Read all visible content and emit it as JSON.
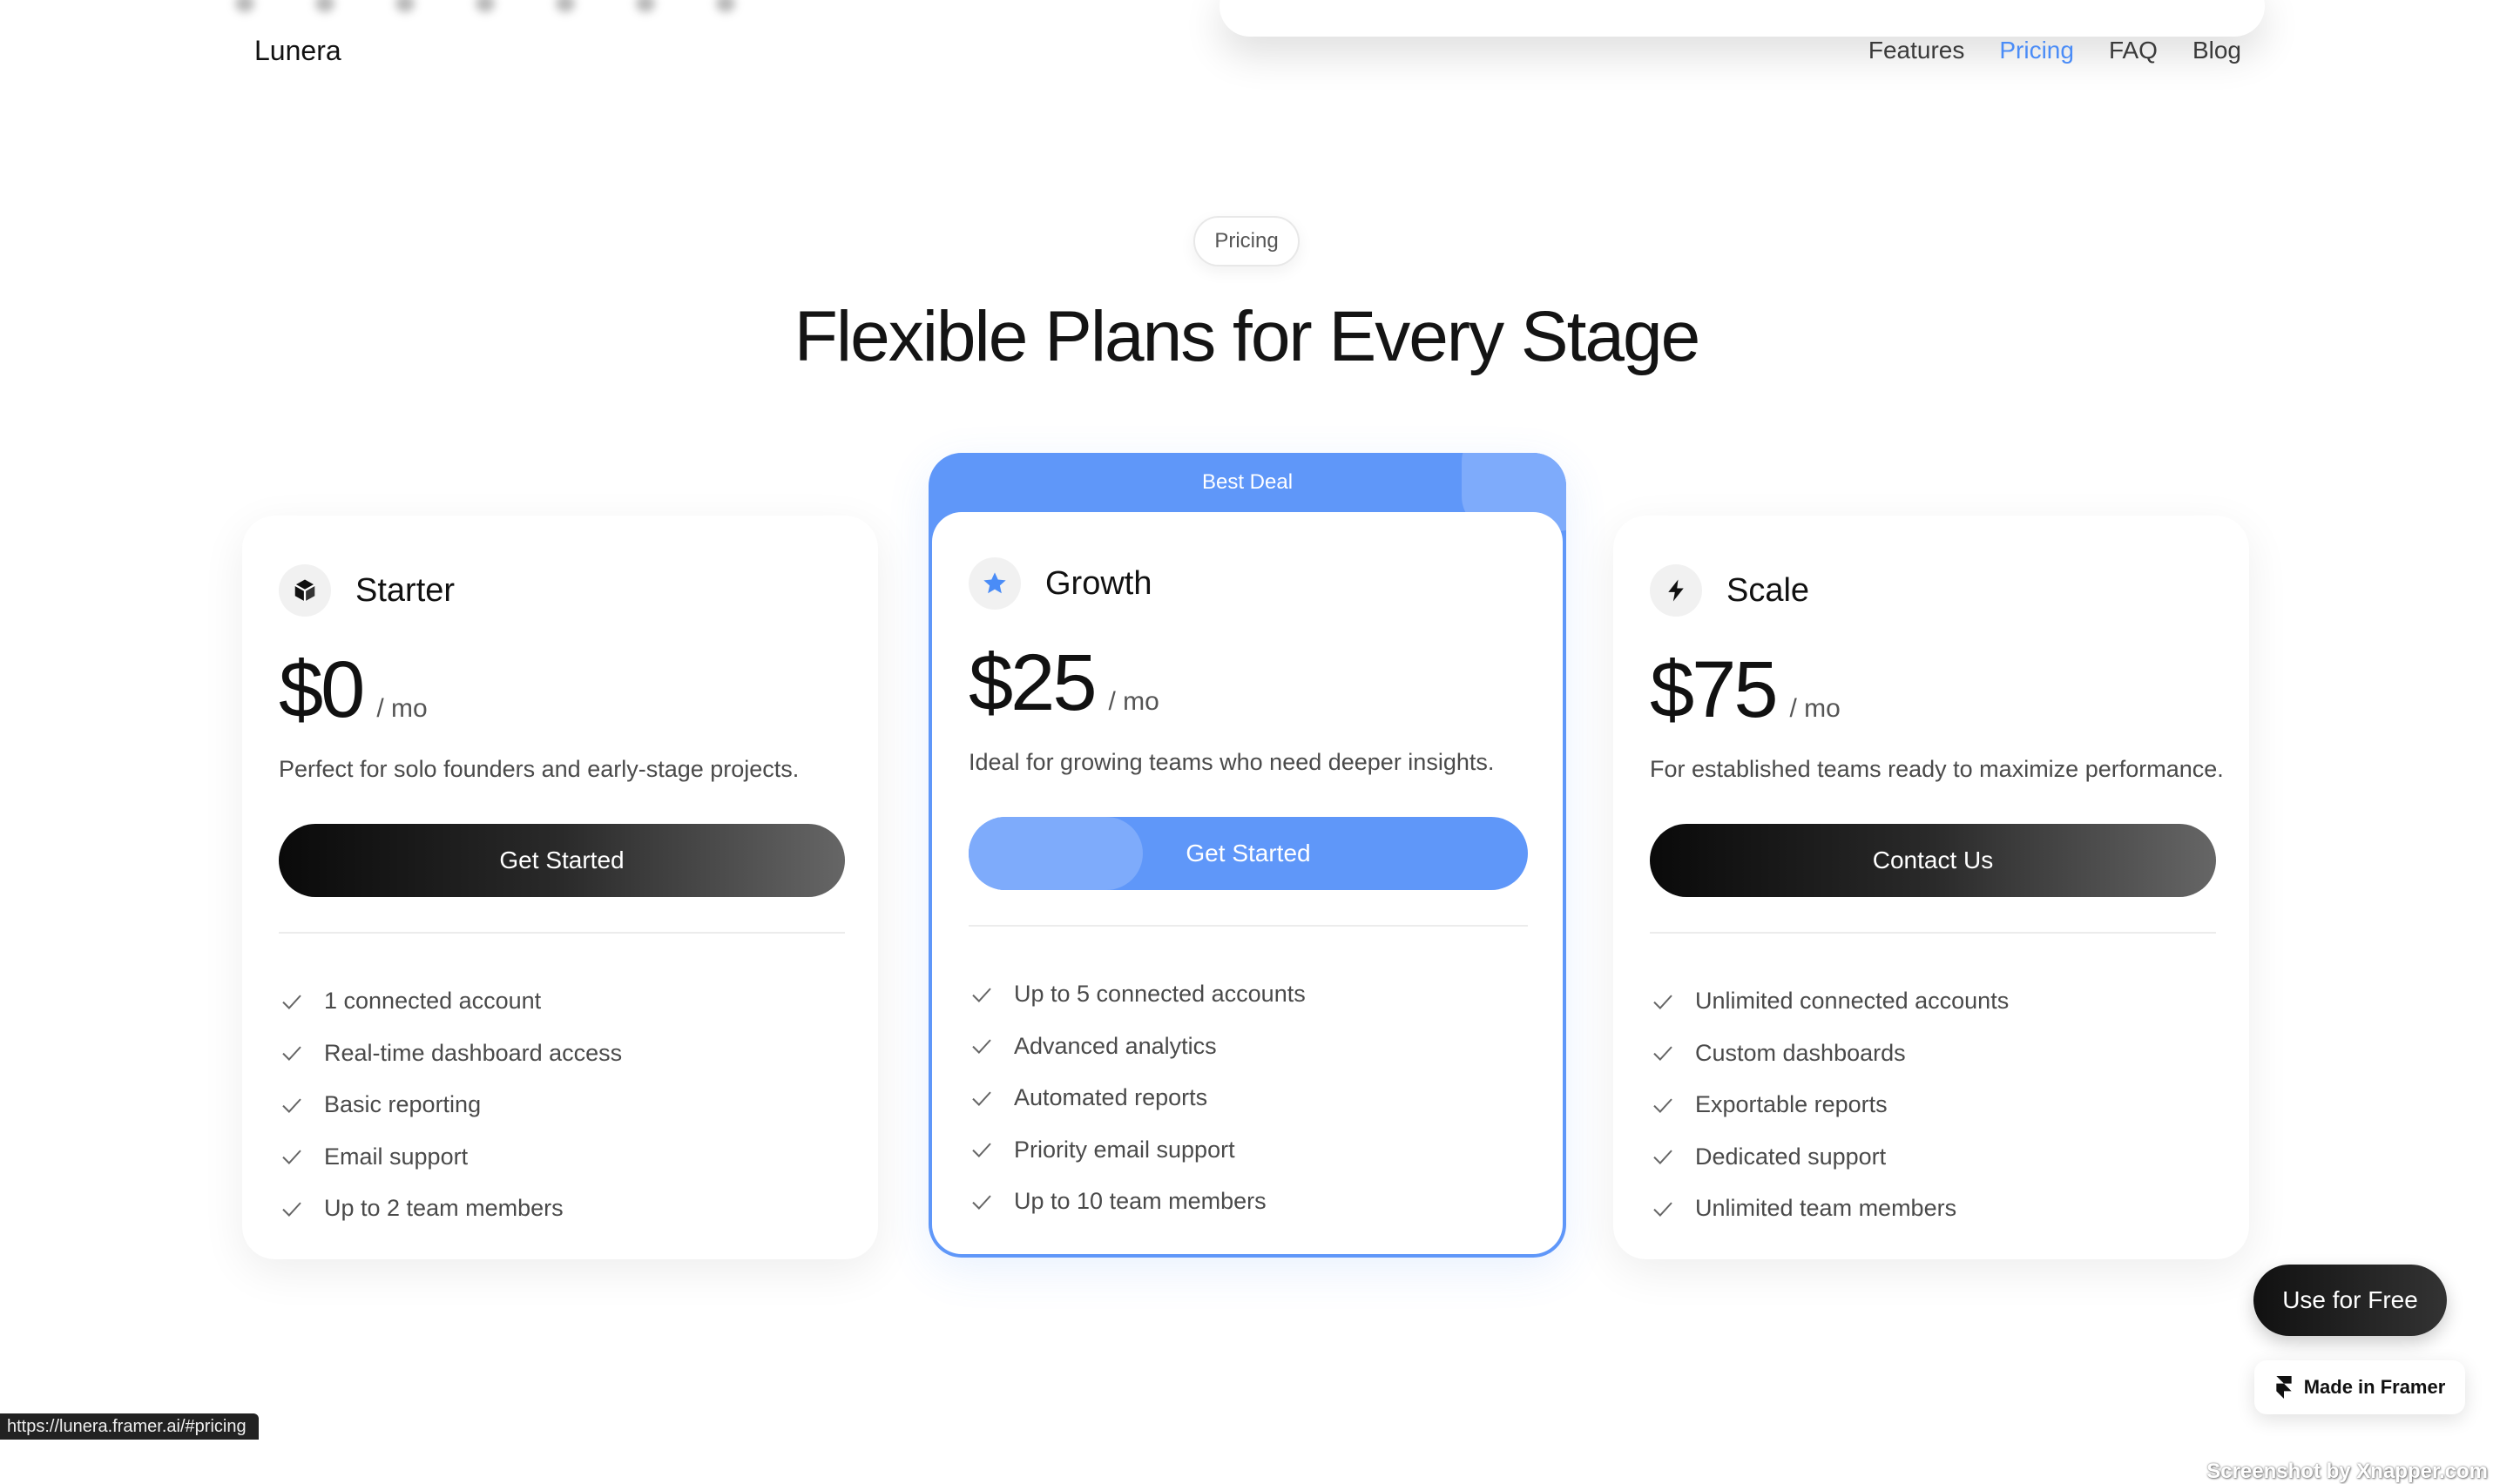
{
  "header": {
    "logo": "Lunera",
    "nav": [
      "Features",
      "Pricing",
      "FAQ",
      "Blog"
    ],
    "active_nav": "Pricing"
  },
  "section": {
    "pill": "Pricing",
    "title": "Flexible Plans for Every Stage"
  },
  "plans": [
    {
      "name": "Starter",
      "icon": "cube-icon",
      "price": "$0",
      "period": "/ mo",
      "description": "Perfect for solo founders and early-stage projects.",
      "cta": "Get Started",
      "features": [
        "1 connected account",
        "Real-time dashboard access",
        "Basic reporting",
        "Email support",
        "Up to 2 team members"
      ]
    },
    {
      "name": "Growth",
      "icon": "star-icon",
      "badge": "Best Deal",
      "price": "$25",
      "period": "/ mo",
      "description": "Ideal for growing teams who need deeper insights.",
      "cta": "Get Started",
      "features": [
        "Up to 5 connected accounts",
        "Advanced analytics",
        "Automated reports",
        "Priority email support",
        "Up to 10 team members"
      ]
    },
    {
      "name": "Scale",
      "icon": "lightning-icon",
      "price": "$75",
      "period": "/ mo",
      "description": "For established teams ready to maximize performance.",
      "cta": "Contact Us",
      "features": [
        "Unlimited connected accounts",
        "Custom dashboards",
        "Exportable reports",
        "Dedicated support",
        "Unlimited team members"
      ]
    }
  ],
  "floating": {
    "use_free": "Use for Free",
    "made_in_framer": "Made in Framer"
  },
  "status_url": "https://lunera.framer.ai/#pricing",
  "watermark": "Screenshot by Xnapper.com",
  "colors": {
    "accent": "#4a8cf7",
    "accent_light": "#7eabfb",
    "dark": "#111111"
  }
}
